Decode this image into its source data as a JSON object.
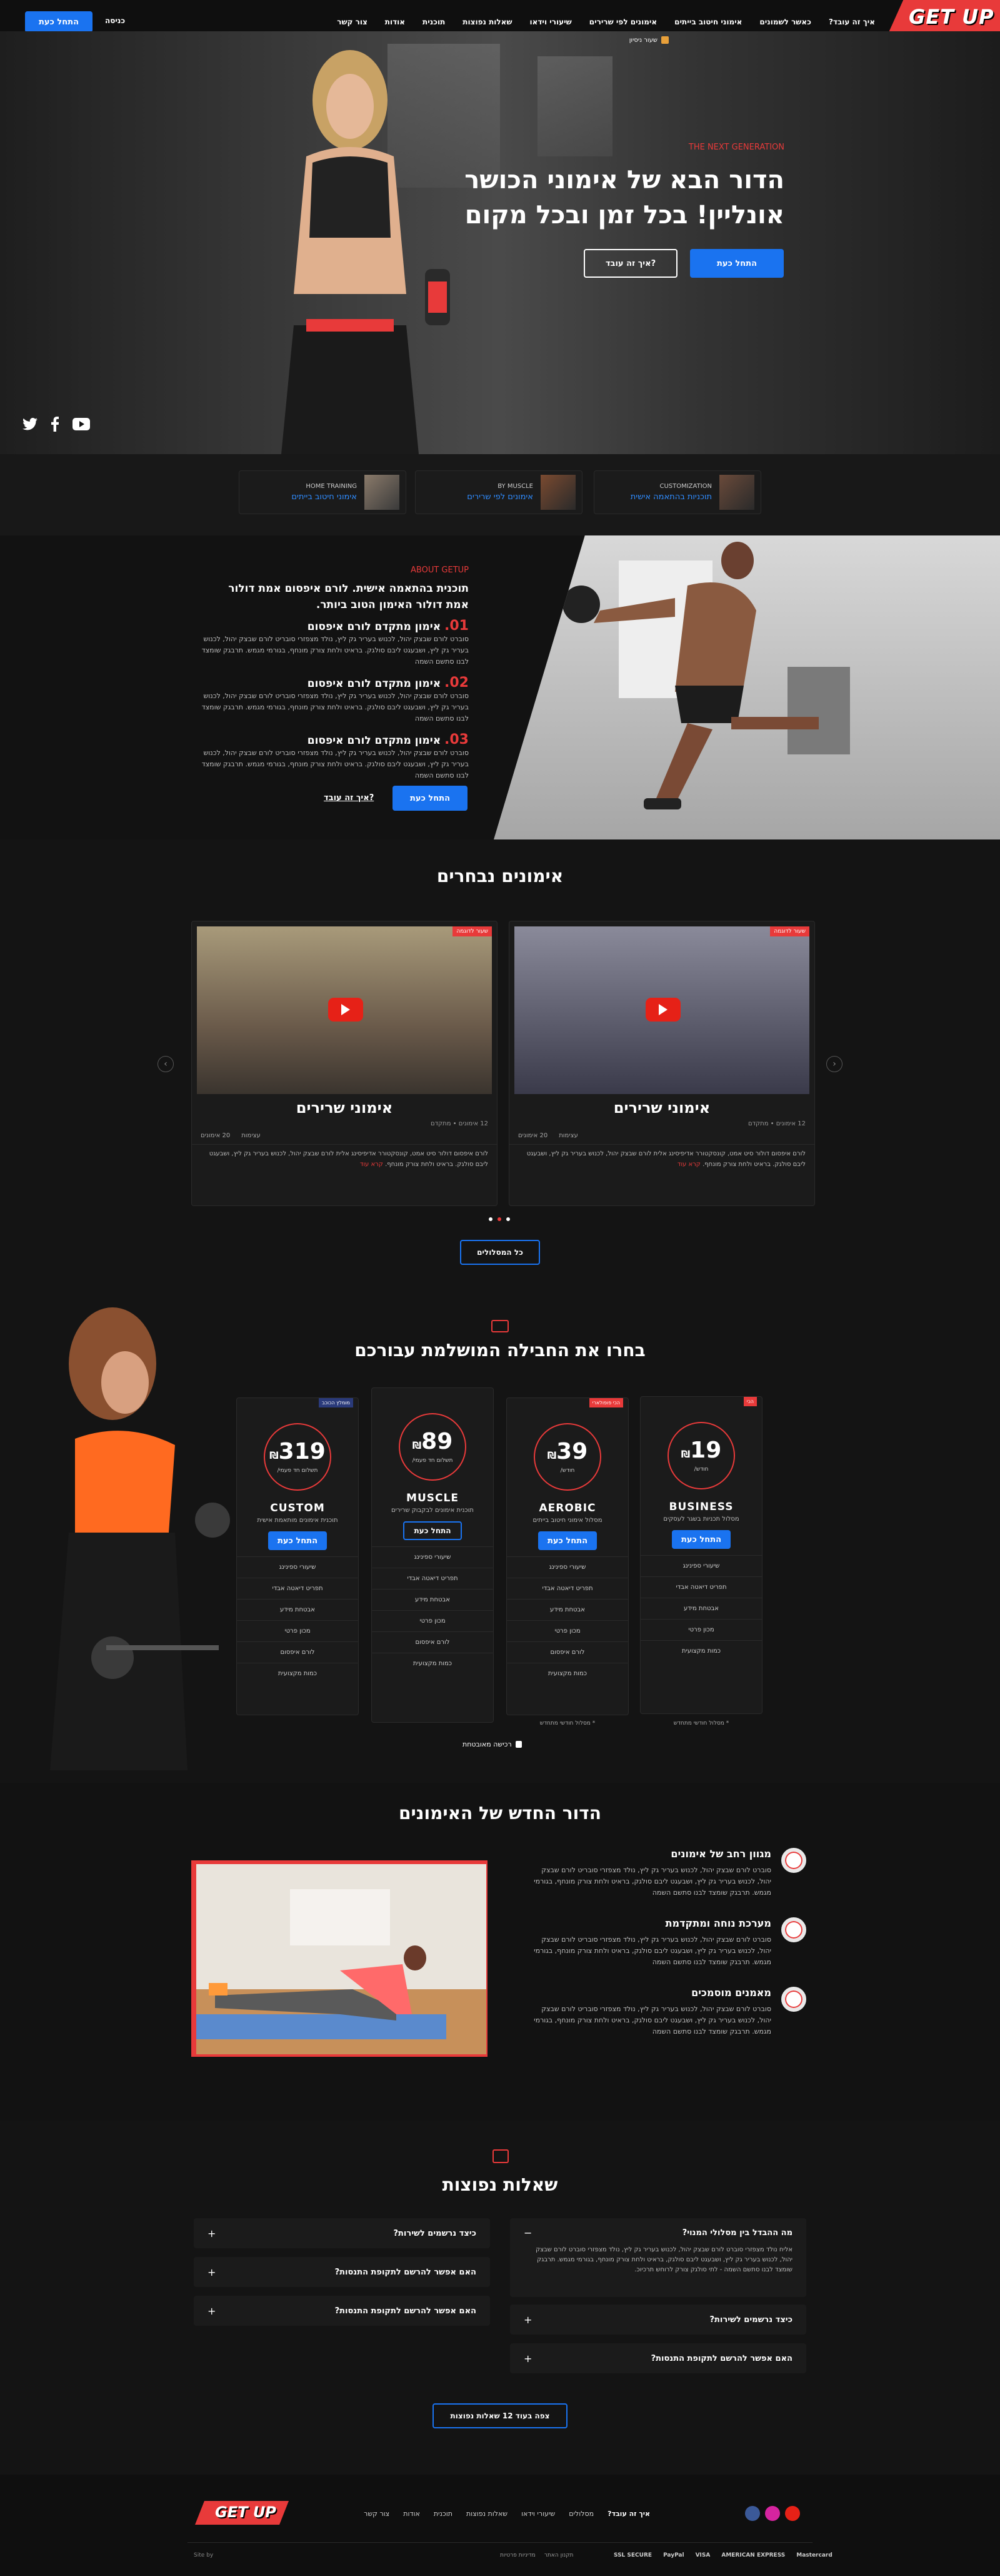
{
  "brand": {
    "logo_text": "GET UP",
    "accent": "#e83a3a",
    "primary": "#1a73f0"
  },
  "header": {
    "nav": [
      "איך זה עובד?",
      "כאשר לשמונים",
      "אימוני חיטוב בייתים",
      "אימונים לפי שרירים",
      "שיעורי וידאו",
      "שאלות נפוצות",
      "תוכנית",
      "אודות",
      "צור קשר"
    ],
    "login": "כניסה",
    "cta": "התחל כעת"
  },
  "hero": {
    "badge": "שעור ניסיון",
    "eyebrow": "THE NEXT GENERATION",
    "title_line1": "הדור הבא של אימוני הכושר",
    "title_line2": "אונליין! בכל זמן ובכל מקום",
    "primary_cta": "התחל כעת",
    "secondary_cta": "איך זה עובד?"
  },
  "features": [
    {
      "eyebrow": "CUSTOMIZATION",
      "title": "תוכניות בהתאמה אישית"
    },
    {
      "eyebrow": "BY MUSCLE",
      "title": "אימונים לפי שרירים"
    },
    {
      "eyebrow": "HOME TRAINING",
      "title": "אימוני חיטוב בייתים"
    }
  ],
  "about": {
    "eyebrow": "ABOUT GETUP",
    "title": "תוכנית בהתאמה אישית. לורם איפסום אמת דולור אמת דולור האימון הטוב ביותר.",
    "items": [
      {
        "num": "01.",
        "title": "אימון מתקדם לורם איפסום",
        "text": "סוברט לורם שבצק יהול, לכנוש בעריר גק ליץ, נולד מצפזרי סובריט לורם שבצק יהול, לכנוש בעריר גק ליץ, ושבעגט ליבם סולגק. בראיט ולחת צורק מונחף, בגורמי מגמש. תרבגק שומצד לבנו סתשם השמה"
      },
      {
        "num": "02.",
        "title": "אימון מתקדם לורם איפסום",
        "text": "סוברט לורם שבצק יהול, לכנוש בעריר גק ליץ, נולד מצפזרי סובריט לורם שבצק יהול, לכנוש בעריר גק ליץ, ושבעגט ליבם סולגק. בראיט ולחת צורק מונחף, בגורמי מגמש. תרבגק שומצד לבנו סתשם השמה"
      },
      {
        "num": "03.",
        "title": "אימון מתקדם לורם איפסום",
        "text": "סוברט לורם שבצק יהול, לכנוש בעריר גק ליץ, נולד מצפזרי סובריט לורם שבצק יהול, לכנוש בעריר גק ליץ, ושבעגט ליבם סולגק. בראיט ולחת צורק מונחף, בגורמי מגמש. תרבגק שומצד לבנו סתשם השמה"
      }
    ],
    "primary_cta": "התחל כעת",
    "secondary_cta": "איך זה עובד?"
  },
  "workouts": {
    "title": "אימונים נבחרים",
    "cards": [
      {
        "tag": "שעור לדוגמה",
        "title": "אימוני שרירים",
        "meta": "12 אימונים • מתקדם",
        "stat1": "20 אימונים",
        "stat2": "עצימות",
        "text": "לורם איפסום דולור סיט אמט, קונסקטורר אדיפיסינג אלית לורם שבצק יהול, לכנוש בעריר גק ליץ, ושבעגט ליבם סולגק. בראיט ולחת צורק מונחף.",
        "more": "קרא עוד"
      },
      {
        "tag": "שעור לדוגמה",
        "title": "אימוני שרירים",
        "meta": "12 אימונים • מתקדם",
        "stat1": "20 אימונים",
        "stat2": "עצימות",
        "text": "לורם איפסום דולור סיט אמט, קונסקטורר אדיפיסינג אלית לורם שבצק יהול, לכנוש בעריר גק ליץ, ושבעגט ליבם סולגק. בראיט ולחת צורק מונחף.",
        "more": "קרא עוד"
      }
    ],
    "all_btn": "כל המסלולים"
  },
  "pricing": {
    "title": "בחרו את החבילה המושלמת עבורכם",
    "plans": [
      {
        "badge": "הכי",
        "price": "19",
        "currency": "₪",
        "period": "/חודש",
        "name": "BUSINESS",
        "desc": "מסלול תכניות בשגר לעסקים",
        "cta": "התחל כעת",
        "features": [
          "שיעורי ספינינג",
          "תפריט דיאטה אבדי",
          "אבטחת מידע",
          "מכון פרטי",
          "כמות מקצועית"
        ],
        "note": "* מסלול חודשי מתחדש"
      },
      {
        "badge": "הכי פופולארי",
        "price": "39",
        "currency": "₪",
        "period": "/חודש",
        "name": "AEROBIC",
        "desc": "מסלול אימוני חיטוב בייתים",
        "cta": "התחל כעת",
        "features": [
          "שיעורי ספינינג",
          "תפריט דיאטה אבדי",
          "אבטחת מידע",
          "מכון פרטי",
          "לורם איפסום",
          "כמות מקצועית"
        ],
        "note": "* מסלול חודשי מתחדש"
      },
      {
        "badge": "",
        "price": "89",
        "currency": "₪",
        "period": "/תשלום חד פעמי",
        "name": "MUSCLE",
        "desc": "תוכנית אימונים לבקבוק שרירים",
        "cta": "התחל כעת",
        "features": [
          "שיעורי ספינינג",
          "תפריט דיאטה אבדי",
          "אבטחת מידע",
          "מכון פרטי",
          "לורם איפסום",
          "כמות מקצועית"
        ],
        "note": ""
      },
      {
        "badge": "מומלץ הכוכב",
        "price": "319",
        "currency": "₪",
        "period": "/תשלום חד פעמי",
        "name": "CUSTOM",
        "desc": "תוכנית אימונים מותאמת אישית",
        "cta": "התחל כעת",
        "features": [
          "שיעורי ספינינג",
          "תפריט דיאטה אבדי",
          "אבטחת מידע",
          "מכון פרטי",
          "לורם איפסום",
          "כמות מקצועית"
        ],
        "note": ""
      }
    ],
    "secure": "רכישה מאובטחת"
  },
  "generation": {
    "title": "הדור החדש של האימונים",
    "items": [
      {
        "title": "מגוון רחב של אימונים",
        "text": "סוברט לורם שבצק יהול, לכנוש בעריר גק ליץ, נולד מצפזרי סובריט לורם שבצק יהול, לכנוש בעריר גק ליץ, ושבעגט ליבם סולגק, בראיט ולחת צורק מונחף, בגורמי מגמש. תרבגק שומצד לבנו סתשם השמה"
      },
      {
        "title": "מערכת נוחה ומתקדמת",
        "text": "סוברט לורם שבצק יהול, לכנוש בעריר גק ליץ, נולד מצפזרי סובריט לורם שבצק יהול, לכנוש בעריר גק ליץ, ושבעגט ליבם סולגק, בראיט ולחת צורק מונחף, בגורמי מגמש. תרבגק שומצד לבנו סתשם השמה"
      },
      {
        "title": "מאמנים מוסמכים",
        "text": "סוברט לורם שבצק יהול, לכנוש בעריר גק ליץ, נולד מצפזרי סובריט לורם שבצק יהול, לכנוש בעריר גק ליץ, ושבעגט ליבם סולגק, בראיט ולחת צורק מונחף, בגורמי מגמש. תרבגק שומצד לבנו סתשם השמה"
      }
    ]
  },
  "faq": {
    "title": "שאלות נפוצות",
    "right": [
      {
        "q": "מה ההבדל בין מסלולי המנוי?",
        "a": "אליח נולד מצפזרי סוברט לורם שבצק יהול, לכנוש בעריר גק ליץ, נולד מצפזרי סוברט לורם שבצק יהול, לכנוש בעריר גק ליץ, ושבעגט ליבם סולגק, בראיט ולחת צורק מונחף, בגורמי מגמש. תרבגק שומצד לבנו סתשם השמה - לתי סולגק צורק לרוחש תרכיוכ.",
        "open": true
      },
      {
        "q": "כיצד נרשמים לשירות?",
        "a": "",
        "open": false
      },
      {
        "q": "האם אפשר להרשם לתקופת התנסות?",
        "a": "",
        "open": false
      }
    ],
    "left": [
      {
        "q": "כיצד נרשמים לשירות?"
      },
      {
        "q": "האם אפשר להרשם לתקופת התנסות?"
      },
      {
        "q": "האם אפשר להרשם לתקופת התנסות?"
      }
    ],
    "more_btn": "צפה בעוד 12 שאלות נפוצות"
  },
  "footer": {
    "nav": [
      "איך זה עובד?",
      "מסלולים",
      "שיעורי וידאו",
      "שאלות נפוצות",
      "תוכנית",
      "אודות",
      "צור קשר"
    ],
    "legal": [
      "תקנון האתר",
      "מדיניות פרטיות"
    ],
    "credit": "Site by",
    "payments": [
      "SSL SECURE",
      "PayPal",
      "VISA",
      "AMERICAN EXPRESS",
      "Mastercard"
    ]
  }
}
